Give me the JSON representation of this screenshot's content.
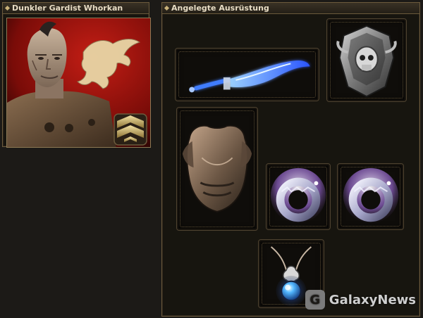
{
  "character_panel": {
    "title": "Dunkler Gardist Whorkan"
  },
  "equipment_panel": {
    "title": "Angelegte Ausrüstung",
    "slots": [
      {
        "name": "weapon-slot",
        "item": "blue-glowing-sword-icon"
      },
      {
        "name": "shield-slot",
        "item": "skull-shield-icon"
      },
      {
        "name": "armor-slot",
        "item": "chest-armor-icon"
      },
      {
        "name": "ring-slot-1",
        "item": "ring-icon"
      },
      {
        "name": "ring-slot-2",
        "item": "ring-icon"
      },
      {
        "name": "amulet-slot",
        "item": "amulet-icon"
      }
    ]
  },
  "watermark": {
    "text": "GalaxyNews"
  },
  "colors": {
    "panel_border": "#6b5a3c",
    "header_text": "#e7dcc4",
    "portrait_background": "#9e1410",
    "glow_blue": "#3f7dff"
  }
}
